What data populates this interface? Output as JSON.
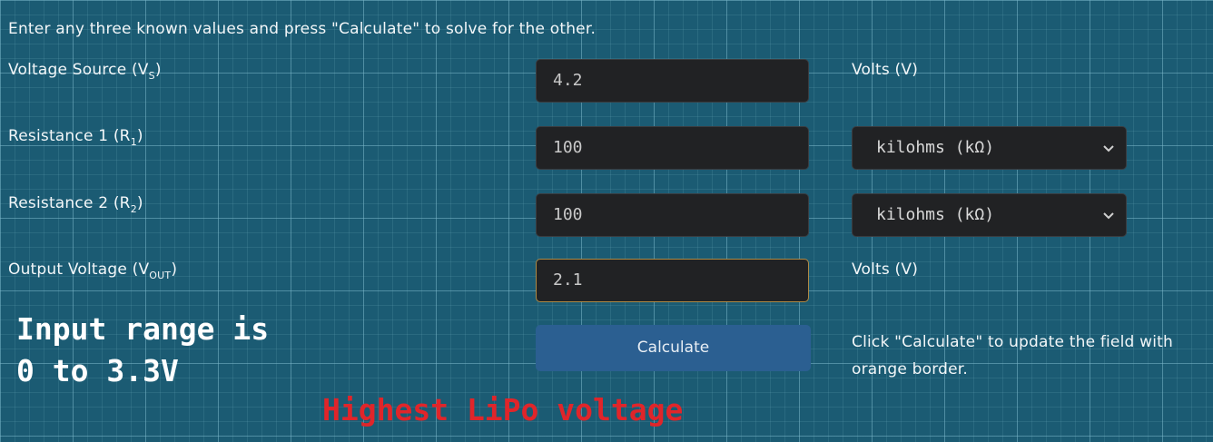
{
  "intro": "Enter any three known values and press \"Calculate\" to solve for the other.",
  "fields": {
    "vs": {
      "label": "Voltage Source (V",
      "sub": "S",
      "label_end": ")",
      "value": "4.2",
      "unit": "Volts (V)"
    },
    "r1": {
      "label": "Resistance 1 (R",
      "sub": "1",
      "label_end": ")",
      "value": "100",
      "unit": "kilohms (kΩ)"
    },
    "r2": {
      "label": "Resistance 2 (R",
      "sub": "2",
      "label_end": ")",
      "value": "100",
      "unit": "kilohms (kΩ)"
    },
    "vout": {
      "label": "Output Voltage (V",
      "sub": "OUT",
      "label_end": ")",
      "value": "2.1",
      "unit": "Volts (V)"
    }
  },
  "calculate_label": "Calculate",
  "hint": "Click \"Calculate\" to update the field with orange border.",
  "annotations": {
    "input_range_line1": "Input range is",
    "input_range_line2": "0 to 3.3V",
    "lipo": "Highest LiPo voltage"
  },
  "colors": {
    "background": "#1b5b73",
    "button": "#2b5f91",
    "active_border": "#b08a45",
    "annotation_red": "#e0252a"
  }
}
